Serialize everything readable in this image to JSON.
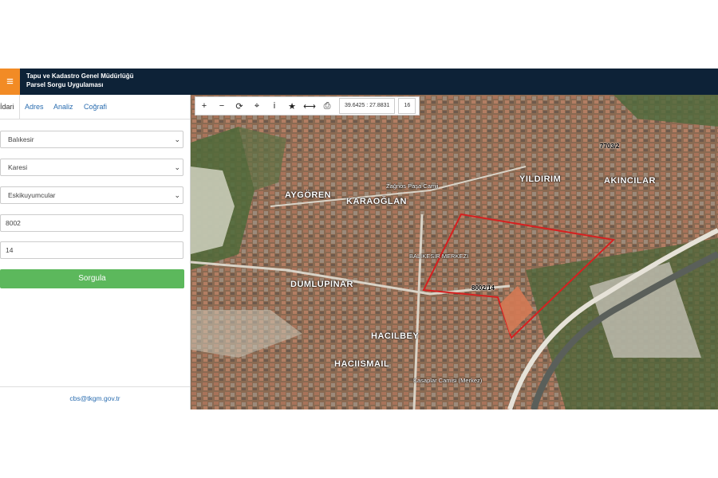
{
  "header": {
    "org_name": "Tapu ve Kadastro Genel Müdürlüğü",
    "app_name": "Parsel Sorgu Uygulaması",
    "menu_icon": "≡"
  },
  "tabs": [
    {
      "label": "İdari"
    },
    {
      "label": "Adres"
    },
    {
      "label": "Analiz"
    },
    {
      "label": "Coğrafi"
    }
  ],
  "form": {
    "province": "Balıkesir",
    "district": "Karesi",
    "neighborhood": "Eskikuyumcular",
    "block": "8002",
    "parcel": "14",
    "query_label": "Sorgula"
  },
  "footer": {
    "email": "cbs@tkgm.gov.tr"
  },
  "toolbar": {
    "icons": {
      "zoom_in": "+",
      "zoom_out": "−",
      "refresh": "⟳",
      "locate": "⌖",
      "info": "i",
      "favorite": "★",
      "measure": "⟷",
      "print": "⎙"
    },
    "coordinates": "39.6425 : 27.8831",
    "zoom": "16"
  },
  "map": {
    "labels": {
      "aygoren": "AYGÖREN",
      "karaoglan": "KARAOĞLAN",
      "yildirim": "YILDIRIM",
      "akincilar": "AKINCILAR",
      "dumlupinar": "DUMLUPINAR",
      "hacilbey": "HACILBEY",
      "hacilsmail": "HACIISMAIL",
      "zagnos": "Zağnos Paşa Camii",
      "merkez": "BALIKESİR MERKEZİ",
      "kasaplar": "Kasaplar Camisi (Merkez)",
      "parcel": "8002/14",
      "parcel_other": "7703/2"
    },
    "colors": {
      "parcel_outline": "#d62020",
      "header": "#0d2237",
      "accent": "#f28b25",
      "button": "#5cb85c"
    }
  }
}
